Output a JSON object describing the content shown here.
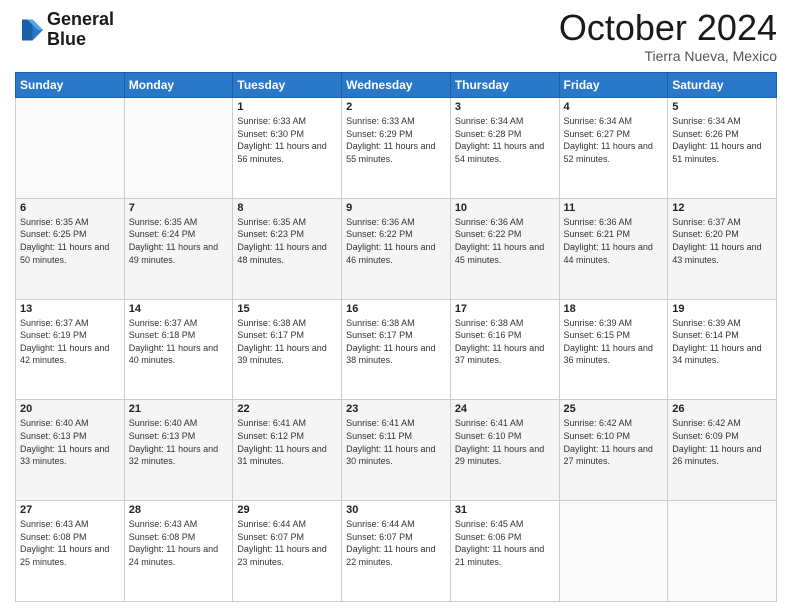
{
  "header": {
    "logo_line1": "General",
    "logo_line2": "Blue",
    "month": "October 2024",
    "location": "Tierra Nueva, Mexico"
  },
  "weekdays": [
    "Sunday",
    "Monday",
    "Tuesday",
    "Wednesday",
    "Thursday",
    "Friday",
    "Saturday"
  ],
  "weeks": [
    [
      {
        "day": "",
        "info": ""
      },
      {
        "day": "",
        "info": ""
      },
      {
        "day": "1",
        "info": "Sunrise: 6:33 AM\nSunset: 6:30 PM\nDaylight: 11 hours and 56 minutes."
      },
      {
        "day": "2",
        "info": "Sunrise: 6:33 AM\nSunset: 6:29 PM\nDaylight: 11 hours and 55 minutes."
      },
      {
        "day": "3",
        "info": "Sunrise: 6:34 AM\nSunset: 6:28 PM\nDaylight: 11 hours and 54 minutes."
      },
      {
        "day": "4",
        "info": "Sunrise: 6:34 AM\nSunset: 6:27 PM\nDaylight: 11 hours and 52 minutes."
      },
      {
        "day": "5",
        "info": "Sunrise: 6:34 AM\nSunset: 6:26 PM\nDaylight: 11 hours and 51 minutes."
      }
    ],
    [
      {
        "day": "6",
        "info": "Sunrise: 6:35 AM\nSunset: 6:25 PM\nDaylight: 11 hours and 50 minutes."
      },
      {
        "day": "7",
        "info": "Sunrise: 6:35 AM\nSunset: 6:24 PM\nDaylight: 11 hours and 49 minutes."
      },
      {
        "day": "8",
        "info": "Sunrise: 6:35 AM\nSunset: 6:23 PM\nDaylight: 11 hours and 48 minutes."
      },
      {
        "day": "9",
        "info": "Sunrise: 6:36 AM\nSunset: 6:22 PM\nDaylight: 11 hours and 46 minutes."
      },
      {
        "day": "10",
        "info": "Sunrise: 6:36 AM\nSunset: 6:22 PM\nDaylight: 11 hours and 45 minutes."
      },
      {
        "day": "11",
        "info": "Sunrise: 6:36 AM\nSunset: 6:21 PM\nDaylight: 11 hours and 44 minutes."
      },
      {
        "day": "12",
        "info": "Sunrise: 6:37 AM\nSunset: 6:20 PM\nDaylight: 11 hours and 43 minutes."
      }
    ],
    [
      {
        "day": "13",
        "info": "Sunrise: 6:37 AM\nSunset: 6:19 PM\nDaylight: 11 hours and 42 minutes."
      },
      {
        "day": "14",
        "info": "Sunrise: 6:37 AM\nSunset: 6:18 PM\nDaylight: 11 hours and 40 minutes."
      },
      {
        "day": "15",
        "info": "Sunrise: 6:38 AM\nSunset: 6:17 PM\nDaylight: 11 hours and 39 minutes."
      },
      {
        "day": "16",
        "info": "Sunrise: 6:38 AM\nSunset: 6:17 PM\nDaylight: 11 hours and 38 minutes."
      },
      {
        "day": "17",
        "info": "Sunrise: 6:38 AM\nSunset: 6:16 PM\nDaylight: 11 hours and 37 minutes."
      },
      {
        "day": "18",
        "info": "Sunrise: 6:39 AM\nSunset: 6:15 PM\nDaylight: 11 hours and 36 minutes."
      },
      {
        "day": "19",
        "info": "Sunrise: 6:39 AM\nSunset: 6:14 PM\nDaylight: 11 hours and 34 minutes."
      }
    ],
    [
      {
        "day": "20",
        "info": "Sunrise: 6:40 AM\nSunset: 6:13 PM\nDaylight: 11 hours and 33 minutes."
      },
      {
        "day": "21",
        "info": "Sunrise: 6:40 AM\nSunset: 6:13 PM\nDaylight: 11 hours and 32 minutes."
      },
      {
        "day": "22",
        "info": "Sunrise: 6:41 AM\nSunset: 6:12 PM\nDaylight: 11 hours and 31 minutes."
      },
      {
        "day": "23",
        "info": "Sunrise: 6:41 AM\nSunset: 6:11 PM\nDaylight: 11 hours and 30 minutes."
      },
      {
        "day": "24",
        "info": "Sunrise: 6:41 AM\nSunset: 6:10 PM\nDaylight: 11 hours and 29 minutes."
      },
      {
        "day": "25",
        "info": "Sunrise: 6:42 AM\nSunset: 6:10 PM\nDaylight: 11 hours and 27 minutes."
      },
      {
        "day": "26",
        "info": "Sunrise: 6:42 AM\nSunset: 6:09 PM\nDaylight: 11 hours and 26 minutes."
      }
    ],
    [
      {
        "day": "27",
        "info": "Sunrise: 6:43 AM\nSunset: 6:08 PM\nDaylight: 11 hours and 25 minutes."
      },
      {
        "day": "28",
        "info": "Sunrise: 6:43 AM\nSunset: 6:08 PM\nDaylight: 11 hours and 24 minutes."
      },
      {
        "day": "29",
        "info": "Sunrise: 6:44 AM\nSunset: 6:07 PM\nDaylight: 11 hours and 23 minutes."
      },
      {
        "day": "30",
        "info": "Sunrise: 6:44 AM\nSunset: 6:07 PM\nDaylight: 11 hours and 22 minutes."
      },
      {
        "day": "31",
        "info": "Sunrise: 6:45 AM\nSunset: 6:06 PM\nDaylight: 11 hours and 21 minutes."
      },
      {
        "day": "",
        "info": ""
      },
      {
        "day": "",
        "info": ""
      }
    ]
  ]
}
